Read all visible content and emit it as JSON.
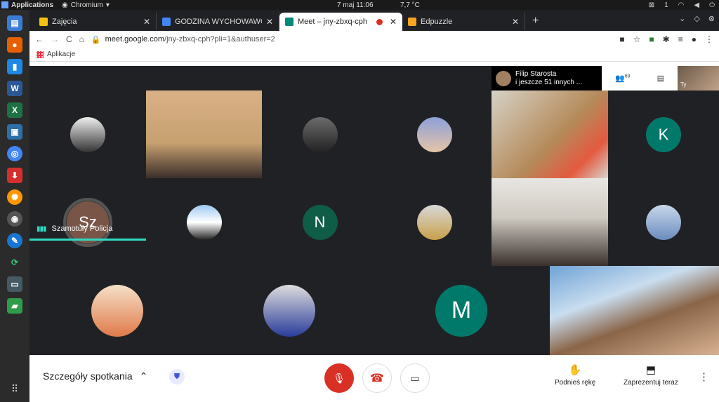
{
  "system_bar": {
    "applications": "Applications",
    "app_menu": "Chromium",
    "clock": "7 maj  11:06",
    "weather": "7,7 °C",
    "workspace": "1"
  },
  "tabs": [
    {
      "title": "Zajęcia",
      "color": "#f4c20d"
    },
    {
      "title": "GODZINA WYCHOWAWCZA",
      "color": "#4285f4"
    },
    {
      "title": "Meet – jny-zbxq-cph",
      "color": "#00897b",
      "active": true
    },
    {
      "title": "Edpuzzle",
      "color": "#f6a623"
    }
  ],
  "address": {
    "host": "meet.google.com",
    "path": "/jny-zbxq-cph?pli=1&authuser=2"
  },
  "bookmarks": {
    "apps": "Aplikacje"
  },
  "meet": {
    "presenter_name": "Filip Starosta",
    "presenter_more": "i jeszcze 51 innych ...",
    "participants_count": "69",
    "self_label": "Ty",
    "speaker_name": "Szamotuły Policja",
    "accent": "#2fd9c4"
  },
  "tiles": {
    "k_initial": "K",
    "sz_initial": "Sz",
    "n_initial": "N",
    "m_initial": "M"
  },
  "bottom": {
    "details": "Szczegóły spotkania",
    "raise_hand": "Podnieś rękę",
    "present_now": "Zaprezentuj teraz"
  }
}
